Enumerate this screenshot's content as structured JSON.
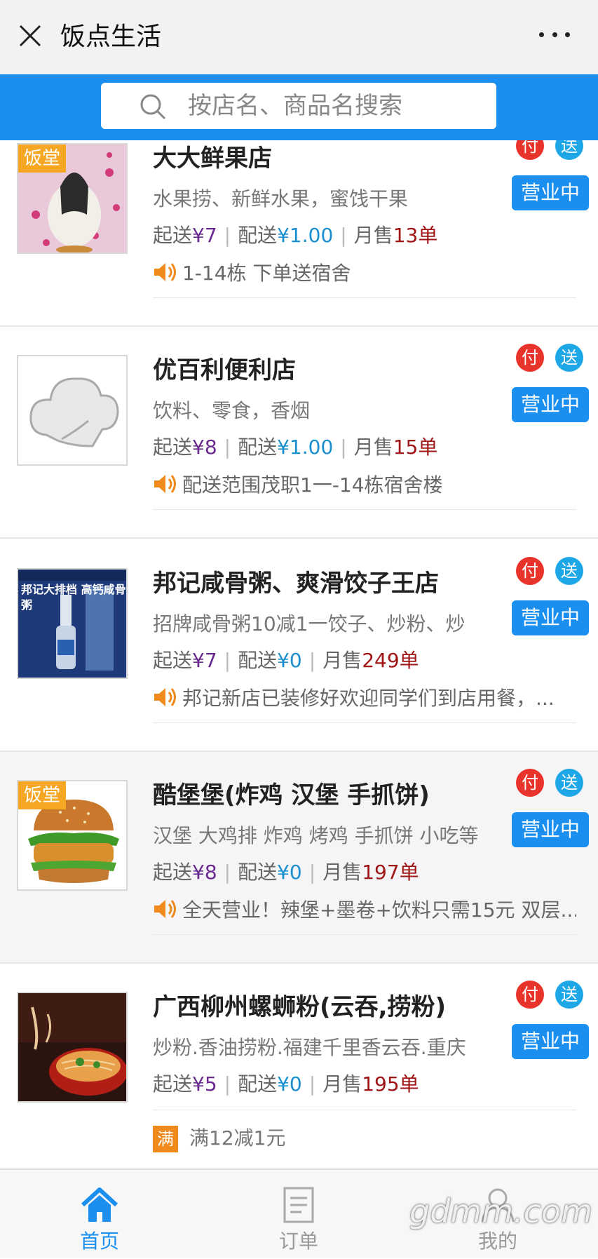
{
  "topbar": {
    "title": "饭点生活"
  },
  "search": {
    "placeholder": "按店名、商品名搜索"
  },
  "colors": {
    "brand_blue": "#1a8ff0",
    "pay_red": "#e8332a",
    "send_blue": "#1ea7e6",
    "tag_orange": "#f5a623"
  },
  "shops": [
    {
      "name": "大大鲜果店",
      "tag": "饭堂",
      "desc": "水果捞、新鲜水果，蜜饯干果",
      "min_label": "起送",
      "min": "¥7",
      "fee_label": "配送",
      "fee": "¥1.00",
      "sales_label": "月售",
      "sales": "13单",
      "notice": "1-14栋 下单送宿舍",
      "pay": "付",
      "send": "送",
      "status": "营业中"
    },
    {
      "name": "优百利便利店",
      "desc": "饮料、零食，香烟",
      "min_label": "起送",
      "min": "¥8",
      "fee_label": "配送",
      "fee": "¥1.00",
      "sales_label": "月售",
      "sales": "15单",
      "notice": "配送范围茂职1一-14栋宿舍楼",
      "pay": "付",
      "send": "送",
      "status": "营业中"
    },
    {
      "name": "邦记咸骨粥、爽滑饺子王店",
      "desc": "招牌咸骨粥10减1一饺子、炒粉、炒",
      "min_label": "起送",
      "min": "¥7",
      "fee_label": "配送",
      "fee": "¥0",
      "sales_label": "月售",
      "sales": "249单",
      "notice": "邦记新店已装修好欢迎同学们到店用餐，...",
      "pay": "付",
      "send": "送",
      "status": "营业中",
      "image_text": "邦记大排档 高钙咸骨粥"
    },
    {
      "name": "酷堡堡(炸鸡 汉堡 手抓饼)",
      "tag": "饭堂",
      "desc": "汉堡 大鸡排 炸鸡 烤鸡 手抓饼 小吃等",
      "min_label": "起送",
      "min": "¥8",
      "fee_label": "配送",
      "fee": "¥0",
      "sales_label": "月售",
      "sales": "197单",
      "notice": "全天营业！辣堡+墨卷+饮料只需15元 双层...",
      "pay": "付",
      "send": "送",
      "status": "营业中"
    },
    {
      "name": "广西柳州螺蛳粉(云吞,捞粉)",
      "desc": "炒粉.香油捞粉.福建千里香云吞.重庆",
      "min_label": "起送",
      "min": "¥5",
      "fee_label": "配送",
      "fee": "¥0",
      "sales_label": "月售",
      "sales": "195单",
      "promo_badge": "满",
      "promo": "满12减1元",
      "pay": "付",
      "send": "送",
      "status": "营业中"
    }
  ],
  "tabs": [
    {
      "label": "首页",
      "icon": "home-icon",
      "active": true
    },
    {
      "label": "订单",
      "icon": "order-icon",
      "active": false
    },
    {
      "label": "我的",
      "icon": "user-icon",
      "active": false
    }
  ],
  "watermark": "gdmm.com"
}
